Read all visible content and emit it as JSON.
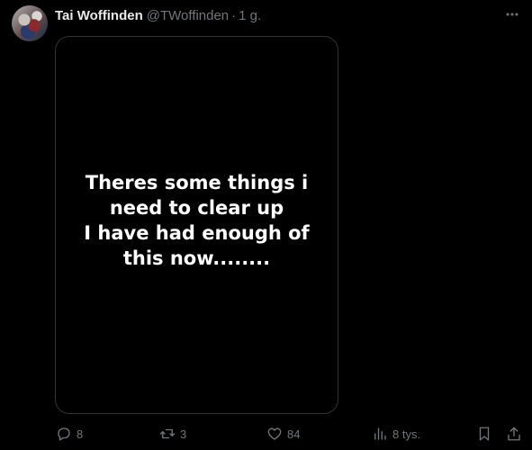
{
  "tweet": {
    "author_name": "Tai Woffinden",
    "author_handle": "@TWoffinden",
    "separator": "·",
    "timestamp": "1 g.",
    "media_lines": [
      "Theres some things i",
      "need to clear up",
      "I have had enough of",
      "this now........"
    ]
  },
  "actions": {
    "replies": "8",
    "retweets": "3",
    "likes": "84",
    "views": "8 tys."
  },
  "icons": {
    "more": "more-horizontal-icon",
    "reply": "reply-icon",
    "retweet": "retweet-icon",
    "like": "heart-icon",
    "views": "views-bar-chart-icon",
    "bookmark": "bookmark-icon",
    "share": "share-icon"
  },
  "colors": {
    "background": "#000000",
    "text_primary": "#e7e9ea",
    "text_secondary": "#71767b",
    "border": "#2f3336"
  }
}
